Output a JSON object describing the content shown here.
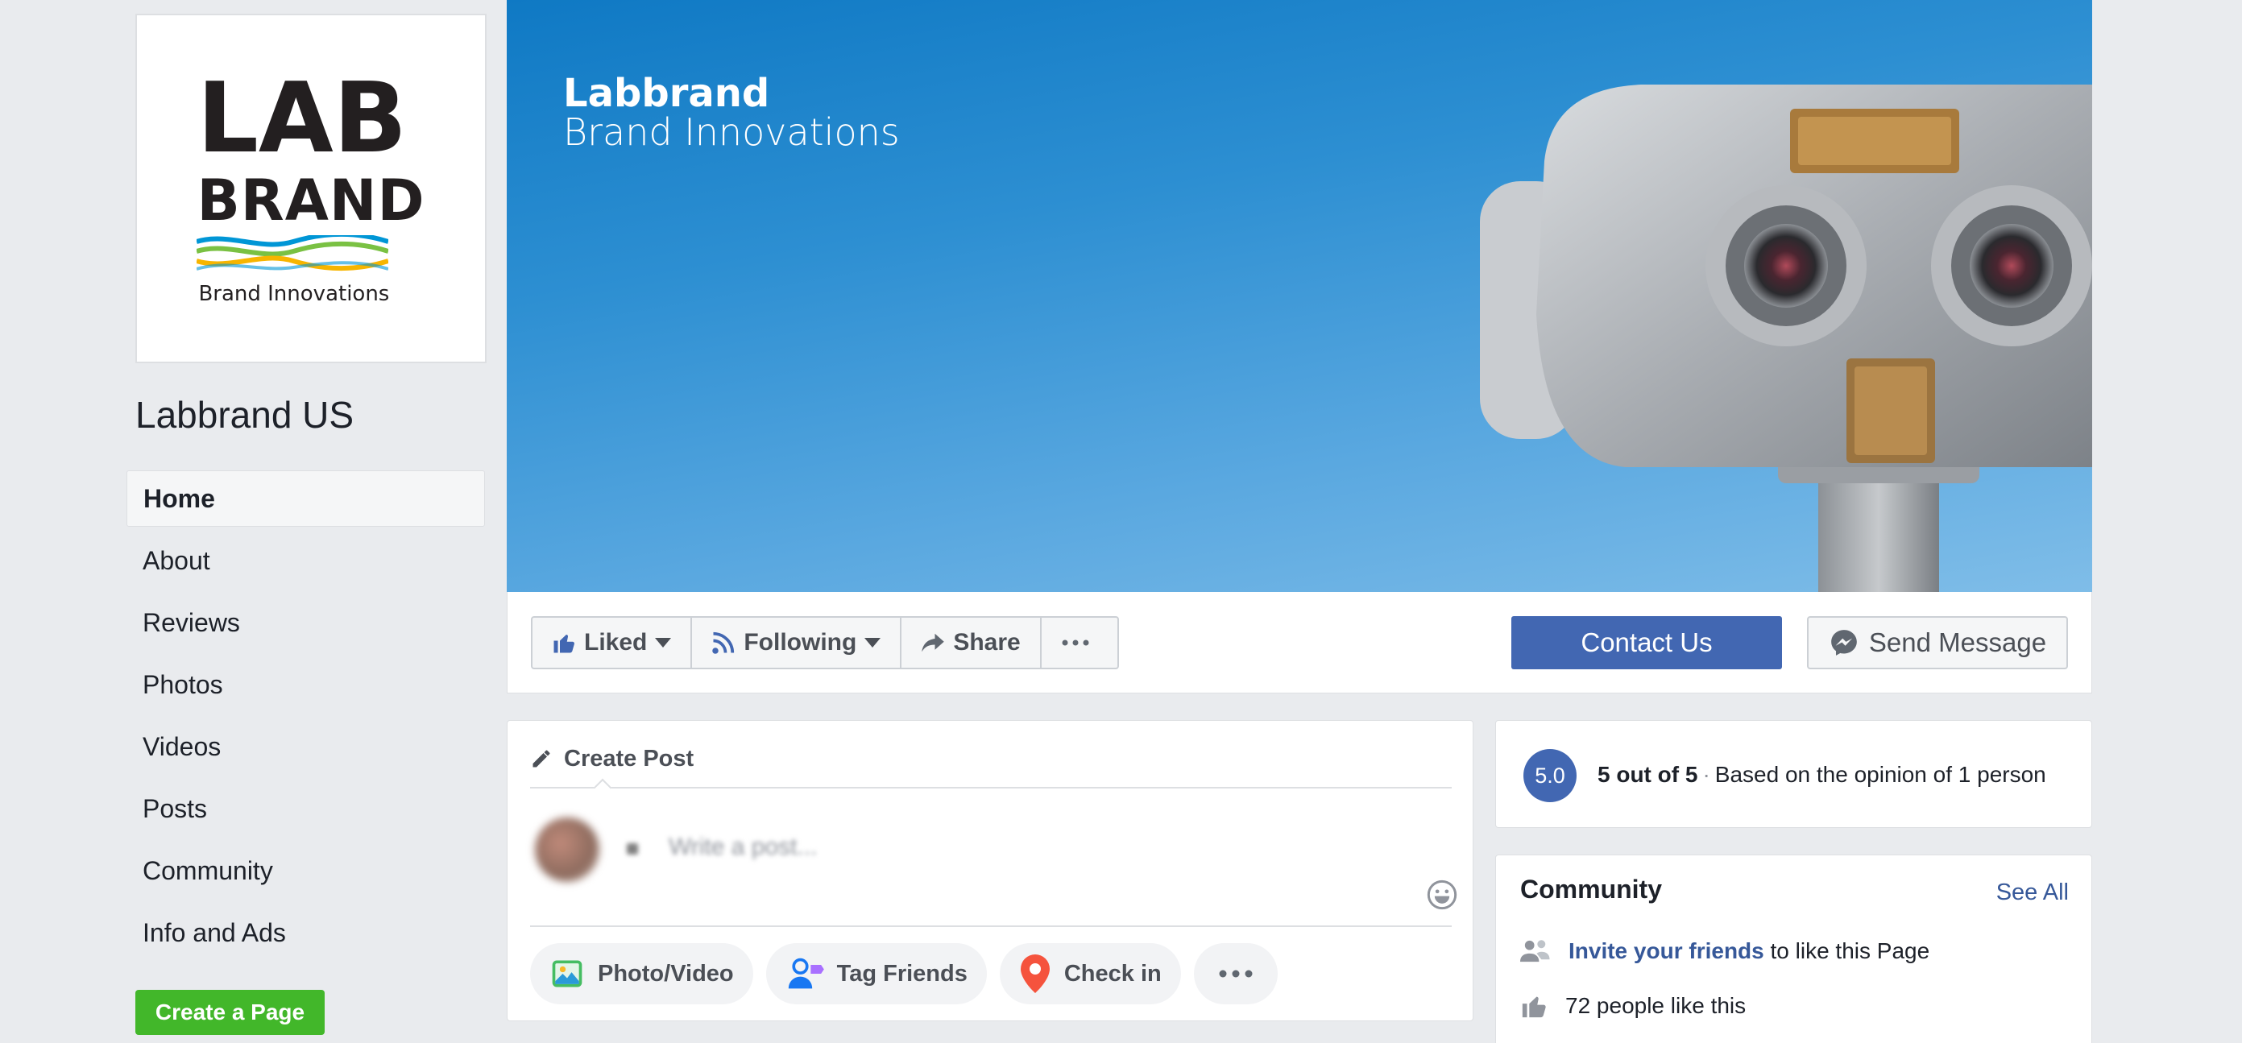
{
  "colors": {
    "page_bg": "#e9ebee",
    "brand_blue": "#4267b2",
    "link_blue": "#365899",
    "create_page_green": "#42b72a",
    "cover_sky": "#1b83cc"
  },
  "profile": {
    "logo_line1": "LAB",
    "logo_line2": "BRAND",
    "logo_tagline": "Brand Innovations",
    "page_name": "Labbrand US"
  },
  "nav": {
    "items": [
      {
        "label": "Home",
        "active": true
      },
      {
        "label": "About"
      },
      {
        "label": "Reviews"
      },
      {
        "label": "Photos"
      },
      {
        "label": "Videos"
      },
      {
        "label": "Posts"
      },
      {
        "label": "Community"
      },
      {
        "label": "Info and Ads"
      }
    ],
    "create_page": "Create a Page"
  },
  "cover": {
    "brand_line1": "Labbrand",
    "brand_line2": "Brand Innovations"
  },
  "actions": {
    "liked": "Liked",
    "following": "Following",
    "share": "Share",
    "contact": "Contact Us",
    "send_message": "Send Message",
    "icons": [
      "like-icon",
      "rss-icon",
      "share-arrow-icon",
      "more-dots-icon",
      "messenger-icon"
    ]
  },
  "create_post": {
    "title": "Create Post",
    "placeholder": "Write a post...",
    "photo_video": "Photo/Video",
    "tag_friends": "Tag Friends",
    "check_in": "Check in"
  },
  "rating": {
    "score": "5.0",
    "summary": "5 out of 5",
    "separator": "·",
    "basis": "Based on the opinion of 1 person"
  },
  "community": {
    "title": "Community",
    "see_all": "See All",
    "invite_link": "Invite your friends",
    "invite_rest": " to like this Page",
    "likes": "72 people like this"
  }
}
